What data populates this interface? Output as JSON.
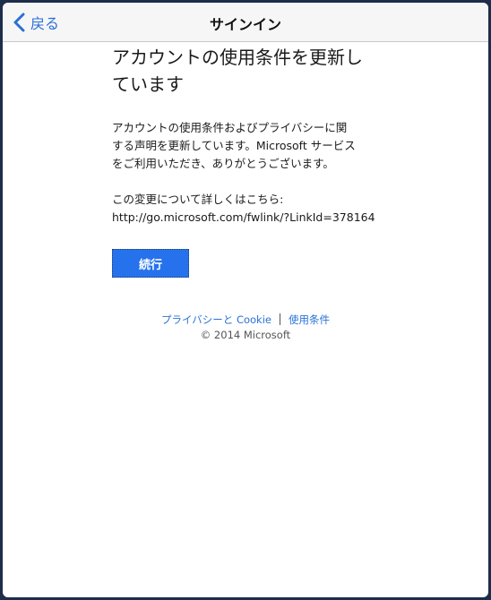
{
  "navbar": {
    "back_label": "戻る",
    "title": "サインイン"
  },
  "content": {
    "heading_line1": "アカウントの使用条件を更新し",
    "heading_line2": "ています",
    "body_line1": "アカウントの使用条件およびプライバシーに関",
    "body_line2": "する声明を更新しています。Microsoft サービス",
    "body_line3": "をご利用いただき、ありがとうございます。",
    "change_text": "この変更について詳しくはこちら:",
    "change_link": "http://go.microsoft.com/fwlink/?LinkId=378164",
    "continue_label": "続行"
  },
  "footer": {
    "privacy_label": "プライバシーと Cookie",
    "terms_label": "使用条件",
    "copyright": "© 2014 Microsoft"
  },
  "colors": {
    "accent": "#2672ec",
    "link": "#2a72d8",
    "frame": "#1d2d4a"
  }
}
